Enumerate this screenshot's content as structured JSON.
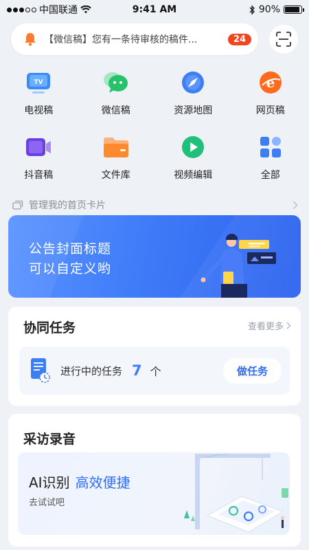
{
  "status_bar": {
    "carrier": "中国联通",
    "time": "9:41 AM",
    "battery": "90%",
    "battery_level": 0.9
  },
  "notice": {
    "text": "【微信稿】您有一条待审核的稿件...",
    "badge": "24",
    "bell_icon": "bell-icon",
    "scan_icon": "scan-icon"
  },
  "grid": [
    {
      "label": "电视稿",
      "icon": "tv-icon"
    },
    {
      "label": "微信稿",
      "icon": "wechat-icon"
    },
    {
      "label": "资源地图",
      "icon": "compass-icon"
    },
    {
      "label": "网页稿",
      "icon": "web-icon"
    },
    {
      "label": "抖音稿",
      "icon": "video-camera-icon"
    },
    {
      "label": "文件库",
      "icon": "folder-icon"
    },
    {
      "label": "视频编辑",
      "icon": "play-icon"
    },
    {
      "label": "全部",
      "icon": "apps-icon"
    }
  ],
  "manage_cards": {
    "label": "管理我的首页卡片"
  },
  "banner": {
    "line1": "公告封面标题",
    "line2": "可以自定义哟"
  },
  "collab": {
    "title": "协同任务",
    "more": "查看更多",
    "task_label": "进行中的任务",
    "task_count": "7",
    "task_unit": "个",
    "button": "做任务"
  },
  "interview": {
    "title": "采访录音",
    "ai_prefix": "AI识别",
    "ai_highlight": "高效便捷",
    "ai_sub": "去试试吧"
  },
  "colors": {
    "accent": "#3f7cf8",
    "badge": "#f0461f",
    "background": "#eef1f6"
  }
}
